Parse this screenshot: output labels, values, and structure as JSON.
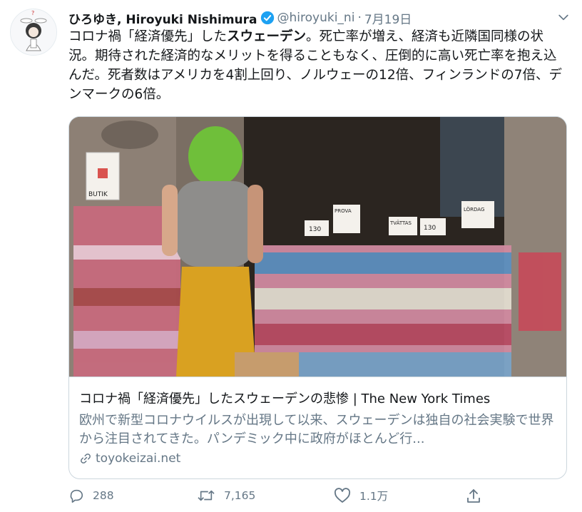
{
  "tweet": {
    "display_name": "ひろゆき, Hiroyuki Nishimura",
    "handle": "@hiroyuki_ni",
    "separator": "·",
    "date": "7月19日",
    "text_part1": "コロナ禍「経済優先」した",
    "text_bold": "スウェーデン",
    "text_part2": "。死亡率が増え、経済も近隣国同様の状況。期待された経済的なメリットを得ることもなく、圧倒的に高い死亡率を抱え込んだ。死者数はアメリカを4割上回り、ノルウェーの12倍、フィンランドの7倍、デンマークの6倍。"
  },
  "card": {
    "title": "コロナ禍「経済優先」したスウェーデンの悲惨 | The New York Times",
    "description": "欧州で新型コロナウイルスが出現して以来、スウェーデンは独自の社会実験で世界から注目されてきた。パンデミック中に政府がほとんど行...",
    "domain": "toyokeizai.net",
    "image_signs": {
      "butik": "BUTIK",
      "price_130a": "130",
      "price_130b": "130",
      "prova": "PROVA",
      "tvattas": "TVÄTTAS",
      "lordag": "LÖRDAG"
    }
  },
  "actions": {
    "replies": "288",
    "retweets": "7,165",
    "likes": "1.1万"
  },
  "colors": {
    "text": "#14171a",
    "secondary": "#657786",
    "border": "#ccd6dd",
    "verified": "#1da1f2"
  },
  "icons": [
    "verified-badge-icon",
    "chevron-down-icon",
    "link-icon",
    "reply-icon",
    "retweet-icon",
    "like-icon",
    "share-icon"
  ]
}
